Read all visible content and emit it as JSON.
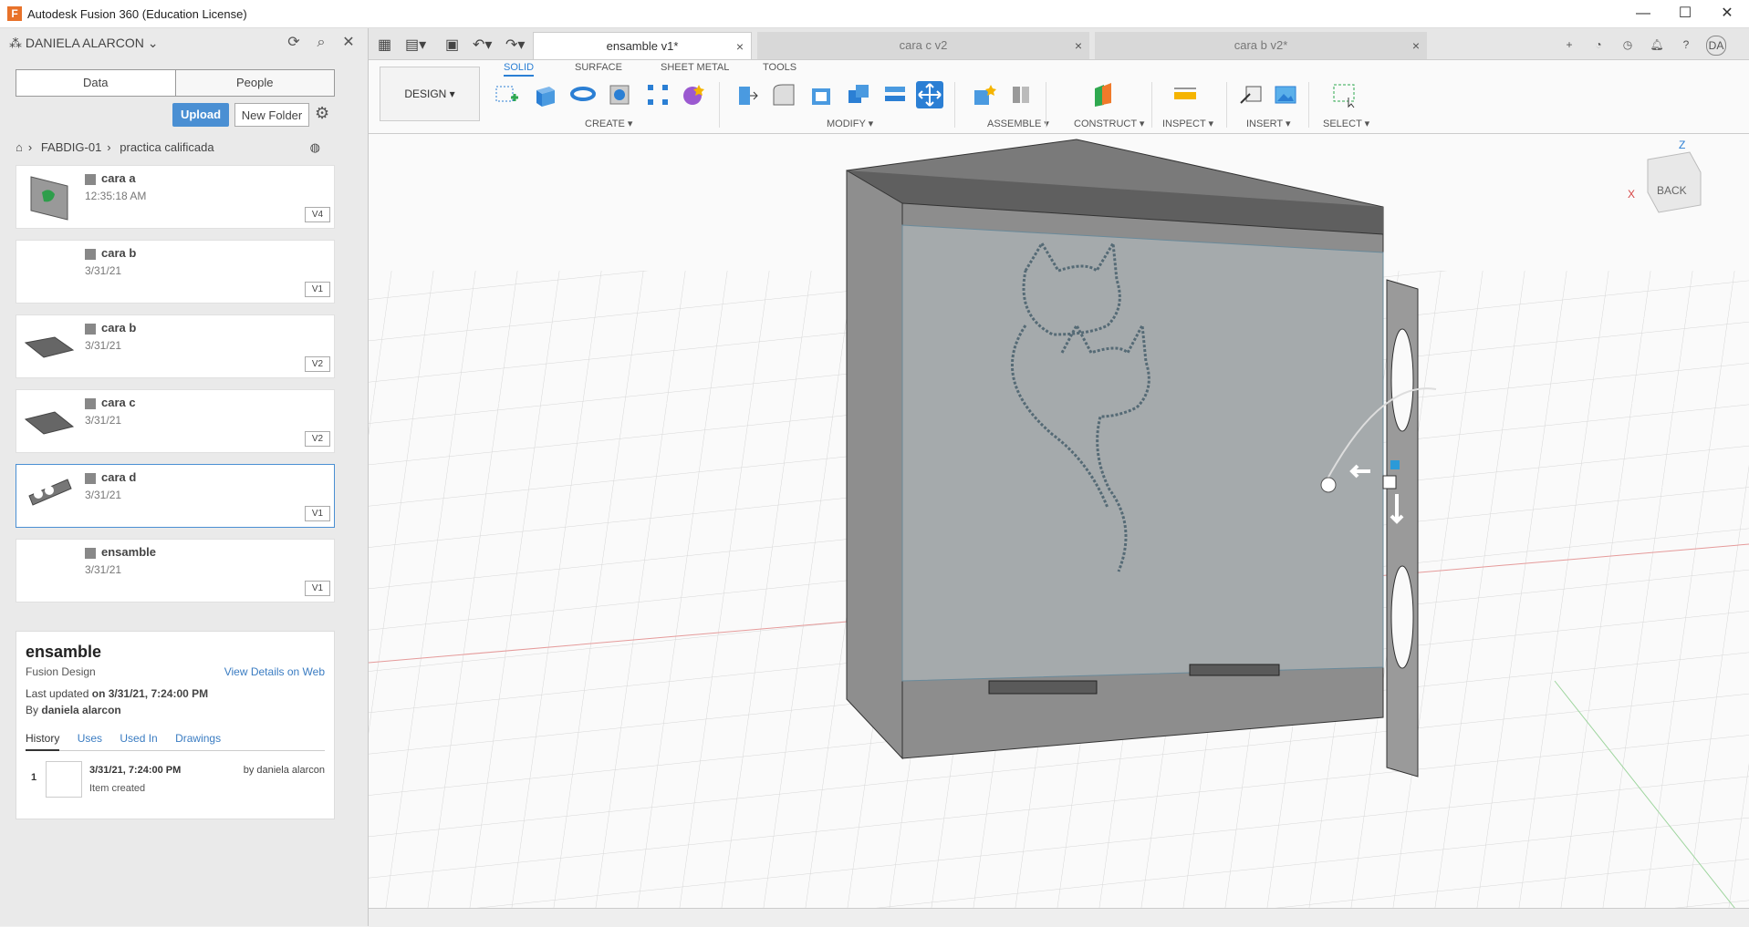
{
  "window": {
    "app_icon": "F",
    "title": "Autodesk Fusion 360 (Education License)",
    "minimize": "—",
    "maximize": "☐",
    "close": "✕"
  },
  "data_panel": {
    "user": "DANIELA ALARCON",
    "tabs": [
      "Data",
      "People"
    ],
    "upload_label": "Upload",
    "new_folder_label": "New Folder",
    "breadcrumb": [
      "FABDIG-01",
      "practica calificada"
    ],
    "files": [
      {
        "name": "cara a",
        "date": "12:35:18 AM",
        "version": "V4"
      },
      {
        "name": "cara b",
        "date": "3/31/21",
        "version": "V1"
      },
      {
        "name": "cara b",
        "date": "3/31/21",
        "version": "V2"
      },
      {
        "name": "cara c",
        "date": "3/31/21",
        "version": "V2"
      },
      {
        "name": "cara d",
        "date": "3/31/21",
        "version": "V1"
      },
      {
        "name": "ensamble",
        "date": "3/31/21",
        "version": "V1"
      }
    ],
    "details": {
      "title": "ensamble",
      "type": "Fusion Design",
      "view_link": "View Details on Web",
      "last_updated_label": "Last updated",
      "last_updated_value": "on 3/31/21, 7:24:00 PM",
      "by_label": "By",
      "by_value": "daniela alarcon",
      "tabs": [
        "History",
        "Uses",
        "Used In",
        "Drawings"
      ],
      "history": {
        "index": "1",
        "datetime": "3/31/21, 7:24:00 PM",
        "by": "by daniela alarcon",
        "action": "Item created"
      }
    }
  },
  "doc_tabs": [
    {
      "label": "ensamble v1*",
      "close": "×"
    },
    {
      "label": "cara c v2",
      "close": "×"
    },
    {
      "label": "cara b v2*",
      "close": "×"
    }
  ],
  "user_initials": "DA",
  "ribbon": {
    "workspace": "DESIGN ▾",
    "tabs": [
      "SOLID",
      "SURFACE",
      "SHEET METAL",
      "TOOLS"
    ],
    "groups": [
      "CREATE ▾",
      "MODIFY ▾",
      "ASSEMBLE ▾",
      "CONSTRUCT ▾",
      "INSPECT ▾",
      "INSERT ▾",
      "SELECT ▾"
    ]
  },
  "viewcube": {
    "face": "BACK",
    "axis_z": "Z",
    "axis_x": "X"
  },
  "colors": {
    "accent": "#2b7fd4",
    "upload": "#4a8fd3",
    "box": "#8e8e8e",
    "box_dark": "#5f5f5f"
  }
}
